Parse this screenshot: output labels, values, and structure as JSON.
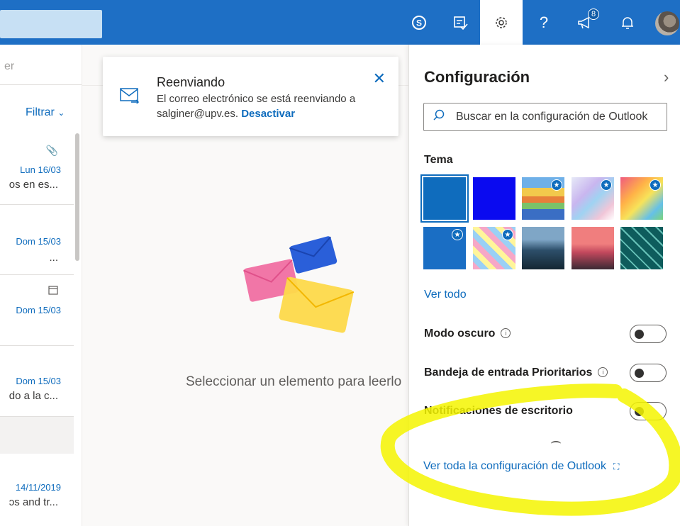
{
  "left_pane": {
    "subheader_fragment": "er",
    "filter_label": "Filtrar",
    "items": [
      {
        "date": "Lun 16/03",
        "preview": "os en es...",
        "icon": "paperclip-icon"
      },
      {
        "date": "Dom 15/03",
        "preview": "...",
        "icon": ""
      },
      {
        "date": "Dom 15/03",
        "preview": "",
        "icon": "calendar-icon"
      },
      {
        "date": "Dom 15/03",
        "preview": "do a la c...",
        "icon": ""
      },
      {
        "date": "14/11/2019",
        "preview": "ɔs and tr...",
        "icon": ""
      }
    ]
  },
  "notification": {
    "title": "Reenviando",
    "body": "El correo electrónico se está reenviando a salginer@upv.es.",
    "action": "Desactivar"
  },
  "reading_pane": {
    "empty_text": "Seleccionar un elemento para leerlo"
  },
  "topbar": {
    "notification_count": "8",
    "icons": [
      "skype-icon",
      "todo-icon",
      "gear-icon",
      "help-icon",
      "megaphone-icon",
      "bell-icon"
    ]
  },
  "settings": {
    "title": "Configuración",
    "search_placeholder": "Buscar en la configuración de Outlook",
    "theme_label": "Tema",
    "see_all": "Ver todo",
    "dark_mode_label": "Modo oscuro",
    "focused_inbox_label": "Bandeja de entrada Prioritarios",
    "desktop_notifications_label": "Notificaciones de escritorio",
    "all_settings_link": "Ver toda la configuración de Outlook"
  },
  "colors": {
    "brand": "#1e6fc5",
    "link": "#0f6cbd",
    "highlighter": "#f4f400"
  }
}
